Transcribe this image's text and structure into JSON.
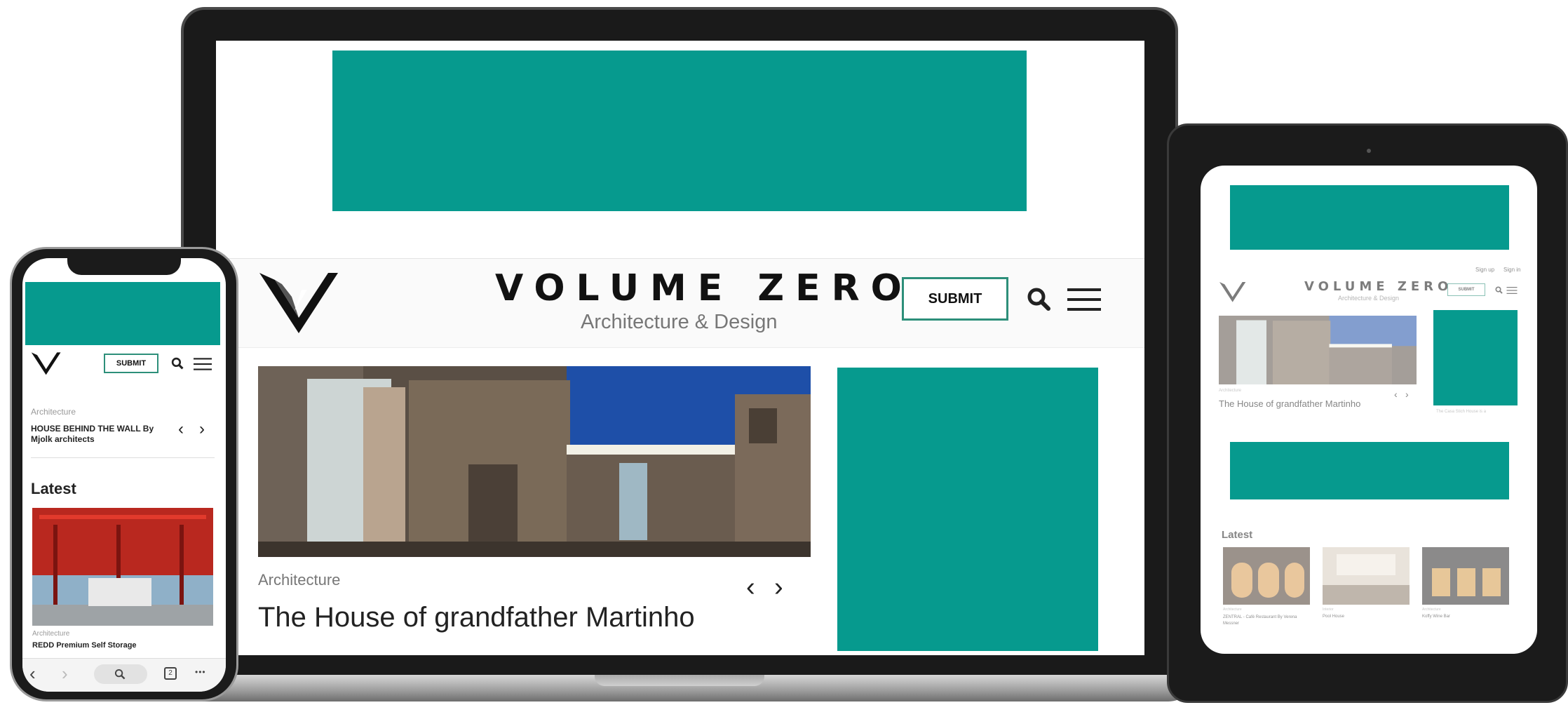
{
  "brand": {
    "name": "VOLUME ZERO",
    "tagline": "Architecture & Design"
  },
  "colors": {
    "accent": "#069a8e",
    "submit_border": "#2d8f7a"
  },
  "laptop": {
    "submit_label": "SUBMIT",
    "hero": {
      "category": "Architecture",
      "title": "The House of grandfather Martinho",
      "prev": "‹",
      "next": "›"
    }
  },
  "phone": {
    "submit_label": "SUBMIT",
    "featured": {
      "category": "Architecture",
      "title": "HOUSE BEHIND THE WALL By Mjolk architects"
    },
    "latest_heading": "Latest",
    "latest_item": {
      "category": "Architecture",
      "title": "REDD Premium Self Storage"
    },
    "toolbar": {
      "tab_count": "2",
      "more": "•••"
    }
  },
  "tablet": {
    "auth": {
      "sign_up": "Sign up",
      "sign_in": "Sign in"
    },
    "submit_label": "SUBMIT",
    "hero": {
      "category": "Architecture",
      "title": "The House of grandfather Martinho",
      "side_caption": "The Casa Stich House is a"
    },
    "latest_heading": "Latest",
    "latest_items": [
      {
        "category": "Architecture",
        "title": "ZENTRAL - Café Restaurant By Verena Messner"
      },
      {
        "category": "Interior",
        "title": "Pool House"
      },
      {
        "category": "Architecture",
        "title": "Koffy Wine Bar"
      }
    ]
  }
}
